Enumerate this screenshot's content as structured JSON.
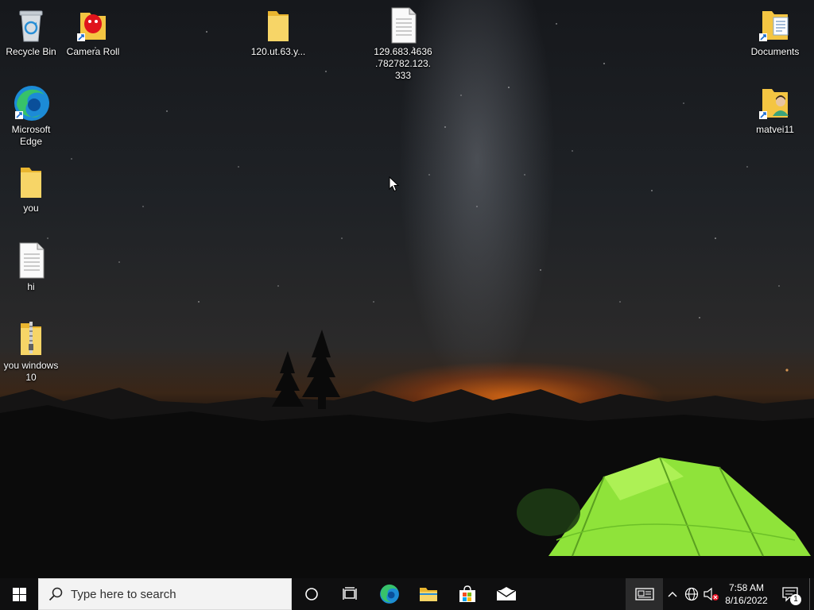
{
  "desktop": {
    "icons": [
      {
        "label": "Recycle Bin",
        "type": "recycle-bin"
      },
      {
        "label": "Camera Roll",
        "type": "folder-shortcut"
      },
      {
        "label": "120.ut.63.y...",
        "type": "folder"
      },
      {
        "label": "129.683.4636.782782.123.333",
        "type": "text-file"
      },
      {
        "label": "Documents",
        "type": "folder-shortcut"
      },
      {
        "label": "Microsoft Edge",
        "type": "edge-shortcut"
      },
      {
        "label": "matvei11",
        "type": "user-folder-shortcut"
      },
      {
        "label": "you",
        "type": "folder"
      },
      {
        "label": "hi",
        "type": "text-file"
      },
      {
        "label": "you windows 10",
        "type": "zip-folder"
      }
    ]
  },
  "taskbar": {
    "search_placeholder": "Type here to search",
    "pinned": [
      {
        "name": "Cortana",
        "icon": "circle-icon"
      },
      {
        "name": "Task View",
        "icon": "task-view-icon"
      },
      {
        "name": "Microsoft Edge",
        "icon": "edge-icon"
      },
      {
        "name": "File Explorer",
        "icon": "folder-icon"
      },
      {
        "name": "Microsoft Store",
        "icon": "store-icon"
      },
      {
        "name": "Mail",
        "icon": "mail-icon"
      }
    ],
    "tray": {
      "time": "7:58 AM",
      "date": "8/16/2022",
      "notification_count": "1"
    }
  },
  "colors": {
    "taskbar_bg": "#0f0f10",
    "search_bg": "#f3f3f3",
    "folder_yellow": "#f4c542",
    "tent_green": "#8fe33a"
  }
}
